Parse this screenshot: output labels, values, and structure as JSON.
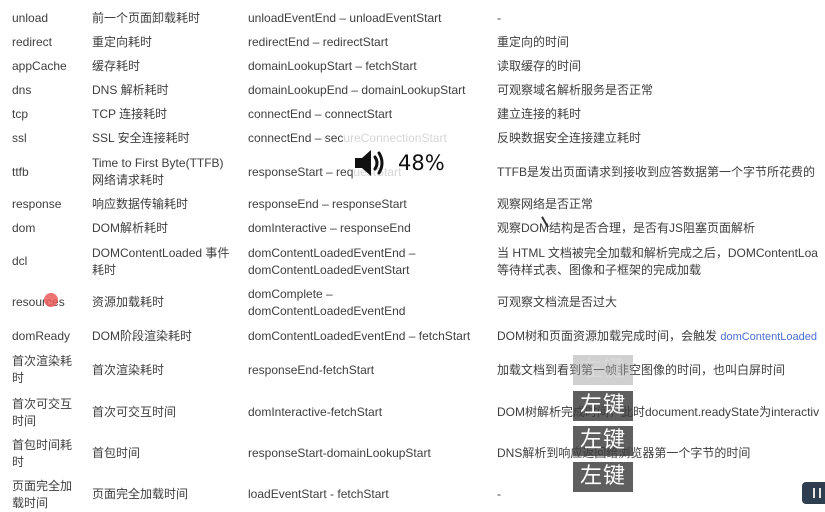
{
  "rows": [
    {
      "key": "unload",
      "name": "前一个页面卸载耗时",
      "formula": "unloadEventEnd – unloadEventStart",
      "desc": "-"
    },
    {
      "key": "redirect",
      "name": "重定向耗时",
      "formula": "redirectEnd – redirectStart",
      "desc": "重定向的时间"
    },
    {
      "key": "appCache",
      "name": "缓存耗时",
      "formula": "domainLookupStart – fetchStart",
      "desc": "读取缓存的时间"
    },
    {
      "key": "dns",
      "name": "DNS 解析耗时",
      "formula": "domainLookupEnd – domainLookupStart",
      "desc": "可观察域名解析服务是否正常"
    },
    {
      "key": "tcp",
      "name": "TCP 连接耗时",
      "formula": "connectEnd – connectStart",
      "desc": "建立连接的耗时"
    },
    {
      "key": "ssl",
      "name": "SSL 安全连接耗时",
      "formula_main": "connectEnd – sec",
      "formula_ghost": "ureConnectionStart",
      "desc": "反映数据安全连接建立耗时"
    },
    {
      "key": "ttfb",
      "name": "Time to First Byte(TTFB) 网络请求耗时",
      "formula_main": "responseStart – req",
      "formula_ghost": "uestStart",
      "desc": "TTFB是发出页面请求到接收到应答数据第一个字节所花费的"
    },
    {
      "key": "response",
      "name": "响应数据传输耗时",
      "formula": "responseEnd – responseStart",
      "desc": "观察网络是否正常"
    },
    {
      "key": "dom",
      "name": "DOM解析耗时",
      "formula": "domInteractive – responseEnd",
      "desc": "观察DOM结构是否合理，是否有JS阻塞页面解析"
    },
    {
      "key": "dcl",
      "name": "DOMContentLoaded 事件耗时",
      "formula": "domContentLoadedEventEnd – domContentLoadedEventStart",
      "desc": "当 HTML 文档被完全加载和解析完成之后，DOMContentLoa",
      "desc2": "等待样式表、图像和子框架的完成加载"
    },
    {
      "key": "resources",
      "name": "资源加载耗时",
      "formula": "domComplete – domContentLoadedEventEnd",
      "desc": "可观察文档流是否过大"
    },
    {
      "key": "domReady",
      "name": "DOM阶段渲染耗时",
      "formula": "domContentLoadedEventEnd – fetchStart",
      "desc": "DOM树和页面资源加载完成时间，会触发",
      "desc_link": "domContentLoaded"
    },
    {
      "key": "首次渲染耗时",
      "name": "首次渲染耗时",
      "formula": "responseEnd-fetchStart",
      "desc": "加载文档到看到第一帧非空图像的时间，也叫白屏时间"
    },
    {
      "key": "首次可交互时间",
      "name": "首次可交互时间",
      "formula": "domInteractive-fetchStart",
      "desc": "DOM树解析完成时间，此时document.readyState为interactiv"
    },
    {
      "key": "首包时间耗时",
      "name": "首包时间",
      "formula": "responseStart-domainLookupStart",
      "desc": "DNS解析到响应返回给浏览器第一个字节的时间"
    },
    {
      "key": "页面完全加载时间",
      "name": "页面完全加载时间",
      "formula": "loadEventStart - fetchStart",
      "desc": "-"
    }
  ],
  "overlay": {
    "volume_icon": "speaker-icon",
    "volume_percent": "48%",
    "click_label": "左键"
  }
}
